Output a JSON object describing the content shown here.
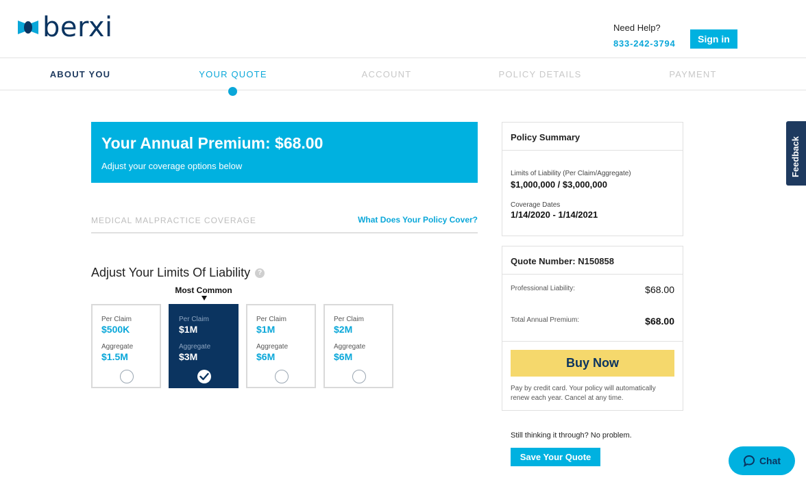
{
  "header": {
    "logo_text": "berxi",
    "help_label": "Need Help?",
    "help_phone": "833-242-3794",
    "signin_label": "Sign in"
  },
  "steps": [
    {
      "label": "ABOUT YOU",
      "state": "done"
    },
    {
      "label": "YOUR QUOTE",
      "state": "active"
    },
    {
      "label": "ACCOUNT",
      "state": "future"
    },
    {
      "label": "POLICY DETAILS",
      "state": "future"
    },
    {
      "label": "PAYMENT",
      "state": "future"
    }
  ],
  "banner": {
    "title": "Your Annual Premium: $68.00",
    "subtitle": "Adjust your coverage options below"
  },
  "coverage": {
    "title": "MEDICAL MALPRACTICE COVERAGE",
    "link": "What Does Your Policy Cover?"
  },
  "limits": {
    "title": "Adjust Your Limits Of Liability",
    "help_glyph": "?",
    "most_common_label": "Most Common",
    "options": [
      {
        "per_claim_label": "Per Claim",
        "per_claim": "$500K",
        "aggregate_label": "Aggregate",
        "aggregate": "$1.5M",
        "selected": false
      },
      {
        "per_claim_label": "Per Claim",
        "per_claim": "$1M",
        "aggregate_label": "Aggregate",
        "aggregate": "$3M",
        "selected": true
      },
      {
        "per_claim_label": "Per Claim",
        "per_claim": "$1M",
        "aggregate_label": "Aggregate",
        "aggregate": "$6M",
        "selected": false
      },
      {
        "per_claim_label": "Per Claim",
        "per_claim": "$2M",
        "aggregate_label": "Aggregate",
        "aggregate": "$6M",
        "selected": false
      }
    ]
  },
  "policy_summary": {
    "title": "Policy Summary",
    "limits_label": "Limits of Liability (Per Claim/Aggregate)",
    "limits_value": "$1,000,000 / $3,000,000",
    "dates_label": "Coverage Dates",
    "dates_value": "1/14/2020 - 1/14/2021"
  },
  "quote": {
    "title": "Quote Number: N150858",
    "professional_label": "Professional Liability:",
    "professional_value": "$68.00",
    "total_label": "Total Annual Premium:",
    "total_value": "$68.00",
    "buy_label": "Buy Now",
    "pay_note": "Pay by credit card. Your policy will automatically renew each year. Cancel at any time."
  },
  "save": {
    "prompt": "Still thinking it through? No problem.",
    "button_label": "Save Your Quote"
  },
  "feedback_label": "Feedback",
  "chat_label": "Chat",
  "colors": {
    "accent": "#00b1e0",
    "navy": "#0b3460",
    "buy": "#f5d86c"
  }
}
